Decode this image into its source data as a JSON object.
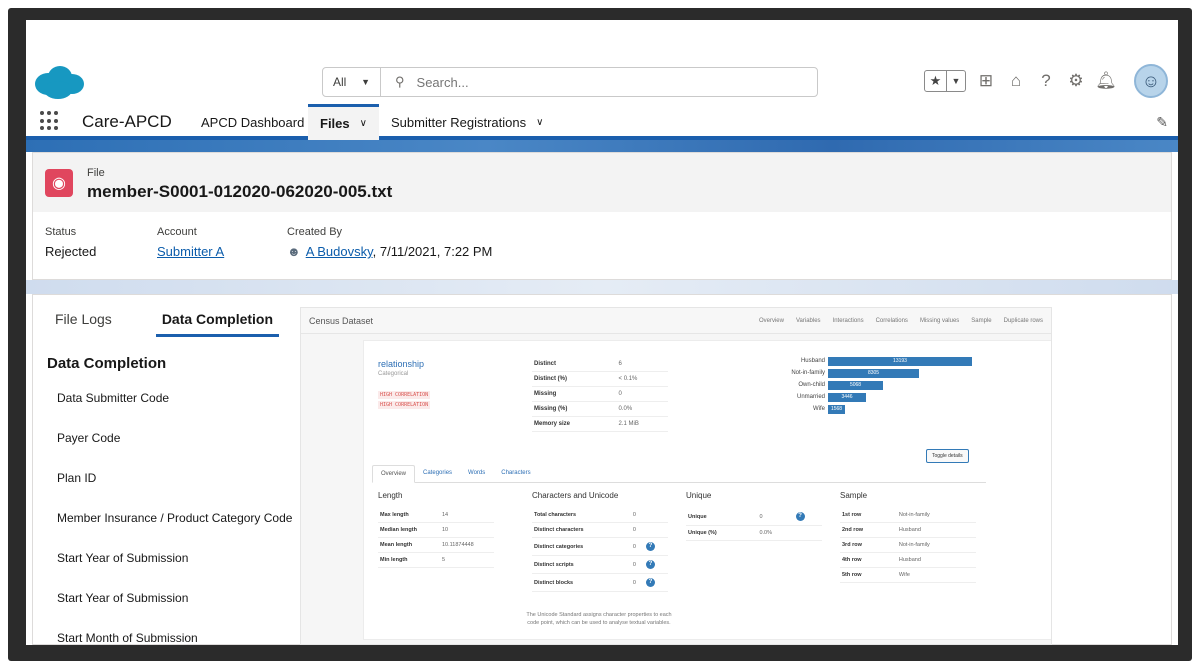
{
  "search": {
    "scope": "All",
    "placeholder": "Search..."
  },
  "nav": {
    "app_name": "Care-APCD",
    "items": [
      {
        "label": "APCD Dashboard"
      },
      {
        "label": "Files"
      },
      {
        "label": "Submitter Registrations"
      }
    ]
  },
  "record": {
    "type_label": "File",
    "name": "member-S0001-012020-062020-005.txt",
    "fields": {
      "status_label": "Status",
      "status_value": "Rejected",
      "account_label": "Account",
      "account_value": "Submitter A",
      "created_label": "Created By",
      "created_user": "A Budovsky",
      "created_rest": ", 7/11/2021, 7:22 PM"
    }
  },
  "tabs": [
    {
      "label": "File Logs"
    },
    {
      "label": "Data Completion"
    }
  ],
  "data_completion": {
    "title": "Data Completion",
    "items": [
      "Data Submitter Code",
      "Payer Code",
      "Plan ID",
      "Member Insurance / Product Category Code",
      "Start Year of Submission",
      "Start Year of Submission",
      "Start Month of Submission"
    ]
  },
  "report": {
    "brand": "Census Dataset",
    "nav": [
      "Overview",
      "Variables",
      "Interactions",
      "Correlations",
      "Missing values",
      "Sample",
      "Duplicate rows"
    ],
    "variable": {
      "name": "relationship",
      "type": "Categorical",
      "warnings": [
        "HIGH CORRELATION",
        "HIGH CORRELATION"
      ]
    },
    "stats": [
      {
        "k": "Distinct",
        "v": "6"
      },
      {
        "k": "Distinct (%)",
        "v": "< 0.1%"
      },
      {
        "k": "Missing",
        "v": "0"
      },
      {
        "k": "Missing (%)",
        "v": "0.0%"
      },
      {
        "k": "Memory size",
        "v": "2.1 MiB"
      }
    ],
    "bars": [
      {
        "label": "Husband",
        "value": 13193,
        "text": "13193"
      },
      {
        "label": "Not-in-family",
        "value": 8305,
        "text": "8305"
      },
      {
        "label": "Own-child",
        "value": 5068,
        "text": "5068"
      },
      {
        "label": "Unmarried",
        "value": 3446,
        "text": "3446"
      },
      {
        "label": "Wife",
        "value": 1568,
        "text": "1568"
      }
    ],
    "toggle": "Toggle details",
    "tabs": [
      "Overview",
      "Categories",
      "Words",
      "Characters"
    ],
    "length": {
      "title": "Length",
      "rows": [
        {
          "k": "Max length",
          "v": "14"
        },
        {
          "k": "Median length",
          "v": "10"
        },
        {
          "k": "Mean length",
          "v": "10.11874448"
        },
        {
          "k": "Min length",
          "v": "5"
        }
      ]
    },
    "chars": {
      "title": "Characters and Unicode",
      "rows": [
        {
          "k": "Total characters",
          "v": "0"
        },
        {
          "k": "Distinct characters",
          "v": "0"
        },
        {
          "k": "Distinct categories",
          "v": "0"
        },
        {
          "k": "Distinct scripts",
          "v": "0"
        },
        {
          "k": "Distinct blocks",
          "v": "0"
        }
      ],
      "note": "The Unicode Standard assigns character properties to each code point, which can be used to analyse textual variables."
    },
    "unique": {
      "title": "Unique",
      "rows": [
        {
          "k": "Unique",
          "v": "0"
        },
        {
          "k": "Unique (%)",
          "v": "0.0%"
        }
      ]
    },
    "sample": {
      "title": "Sample",
      "rows": [
        {
          "k": "1st row",
          "v": "Not-in-family"
        },
        {
          "k": "2nd row",
          "v": "Husband"
        },
        {
          "k": "3rd row",
          "v": "Not-in-family"
        },
        {
          "k": "4th row",
          "v": "Husband"
        },
        {
          "k": "5th row",
          "v": "Wife"
        }
      ]
    }
  }
}
